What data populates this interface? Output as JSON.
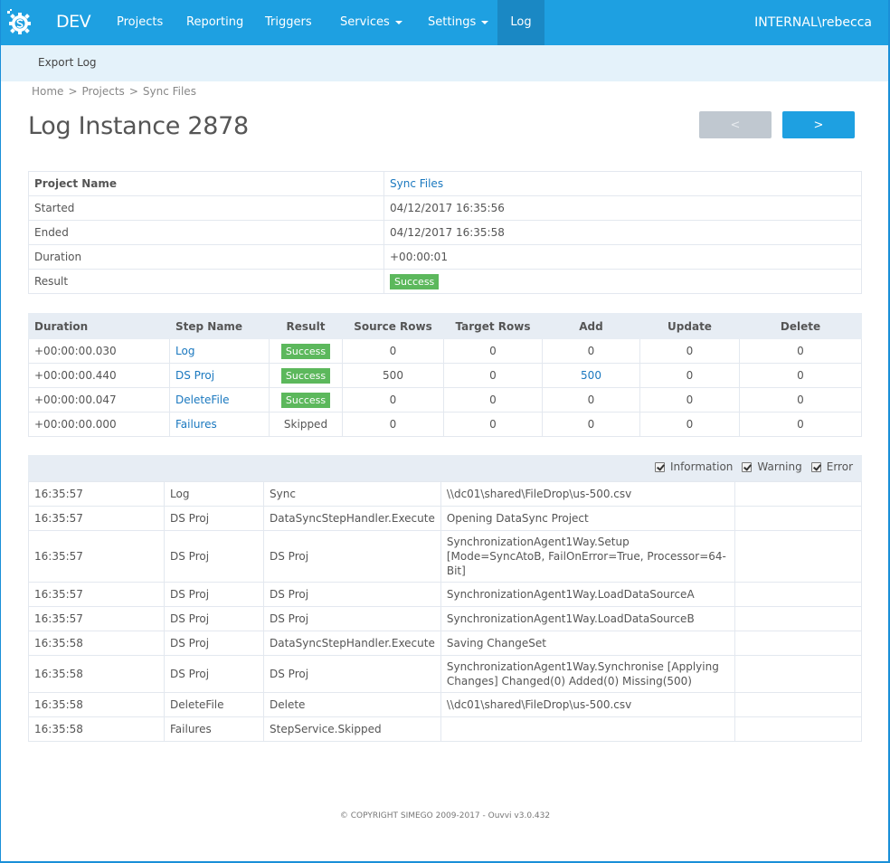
{
  "app": {
    "brand": "DEV",
    "user": "INTERNAL\\rebecca"
  },
  "nav": {
    "items": [
      {
        "label": "Projects",
        "dropdown": false,
        "active": false
      },
      {
        "label": "Reporting",
        "dropdown": false,
        "active": false
      },
      {
        "label": "Triggers",
        "dropdown": false,
        "active": false
      },
      {
        "label": "Services",
        "dropdown": true,
        "active": false
      },
      {
        "label": "Settings",
        "dropdown": true,
        "active": false
      },
      {
        "label": "Log",
        "dropdown": false,
        "active": true
      }
    ]
  },
  "subnav": {
    "export_label": "Export Log"
  },
  "breadcrumb": [
    "Home",
    "Projects",
    "Sync Files"
  ],
  "breadcrumb_separator": ">",
  "page": {
    "title": "Log Instance 2878",
    "prev_label": "<",
    "next_label": ">"
  },
  "info": {
    "rows": [
      {
        "key": "Project Name",
        "value": "Sync Files"
      },
      {
        "key": "Started",
        "value": "04/12/2017 16:35:56"
      },
      {
        "key": "Ended",
        "value": "04/12/2017 16:35:58"
      },
      {
        "key": "Duration",
        "value": "+00:00:01"
      },
      {
        "key": "Result",
        "value": "Success"
      }
    ]
  },
  "steps": {
    "headers": [
      "Duration",
      "Step Name",
      "Result",
      "Source Rows",
      "Target Rows",
      "Add",
      "Update",
      "Delete"
    ],
    "rows": [
      {
        "duration": "+00:00:00.030",
        "step": "Log",
        "result": "Success",
        "source": "0",
        "target": "0",
        "add": "0",
        "update": "0",
        "delete": "0"
      },
      {
        "duration": "+00:00:00.440",
        "step": "DS Proj",
        "result": "Success",
        "source": "500",
        "target": "0",
        "add": "500",
        "update": "0",
        "delete": "0"
      },
      {
        "duration": "+00:00:00.047",
        "step": "DeleteFile",
        "result": "Success",
        "source": "0",
        "target": "0",
        "add": "0",
        "update": "0",
        "delete": "0"
      },
      {
        "duration": "+00:00:00.000",
        "step": "Failures",
        "result": "Skipped",
        "source": "0",
        "target": "0",
        "add": "0",
        "update": "0",
        "delete": "0"
      }
    ]
  },
  "log_filters": [
    {
      "label": "Information",
      "checked": true
    },
    {
      "label": "Warning",
      "checked": true
    },
    {
      "label": "Error",
      "checked": true
    }
  ],
  "log": {
    "rows": [
      {
        "time": "16:35:57",
        "step": "Log",
        "source": "Sync",
        "message": "\\\\dc01\\shared\\FileDrop\\us-500.csv",
        "extra": ""
      },
      {
        "time": "16:35:57",
        "step": "DS Proj",
        "source": "DataSyncStepHandler.Execute",
        "message": "Opening DataSync Project",
        "extra": ""
      },
      {
        "time": "16:35:57",
        "step": "DS Proj",
        "source": "DS Proj",
        "message": "SynchronizationAgent1Way.Setup [Mode=SyncAtoB, FailOnError=True, Processor=64-Bit]",
        "extra": ""
      },
      {
        "time": "16:35:57",
        "step": "DS Proj",
        "source": "DS Proj",
        "message": "SynchronizationAgent1Way.LoadDataSourceA",
        "extra": ""
      },
      {
        "time": "16:35:57",
        "step": "DS Proj",
        "source": "DS Proj",
        "message": "SynchronizationAgent1Way.LoadDataSourceB",
        "extra": ""
      },
      {
        "time": "16:35:58",
        "step": "DS Proj",
        "source": "DataSyncStepHandler.Execute",
        "message": "Saving ChangeSet",
        "extra": ""
      },
      {
        "time": "16:35:58",
        "step": "DS Proj",
        "source": "DS Proj",
        "message": "SynchronizationAgent1Way.Synchronise [Applying Changes] Changed(0) Added(0) Missing(500)",
        "extra": ""
      },
      {
        "time": "16:35:58",
        "step": "DeleteFile",
        "source": "Delete",
        "message": "\\\\dc01\\shared\\FileDrop\\us-500.csv",
        "extra": ""
      },
      {
        "time": "16:35:58",
        "step": "Failures",
        "source": "StepService.Skipped",
        "message": "",
        "extra": ""
      }
    ]
  },
  "footer": "© COPYRIGHT SIMEGO 2009-2017 - Ouvvi v3.0.432",
  "colors": {
    "primary": "#1ea0e1",
    "nav_active": "#1a88c4",
    "subbar": "#e4f2fa",
    "success": "#5cb85c",
    "link": "#1a78bf",
    "table_header": "#e7edf4"
  }
}
